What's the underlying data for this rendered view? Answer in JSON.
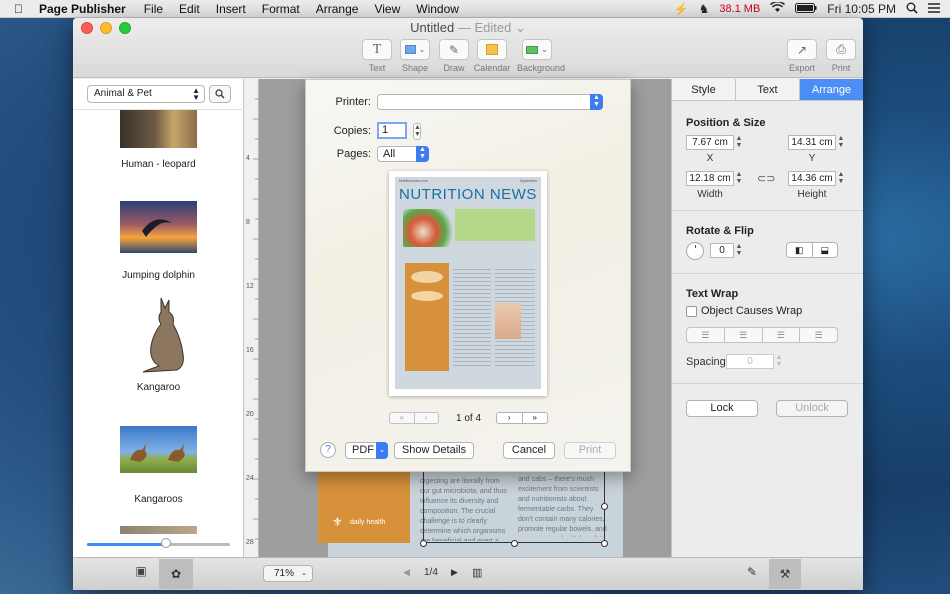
{
  "menubar": {
    "app": "Page Publisher",
    "items": [
      "File",
      "Edit",
      "Insert",
      "Format",
      "Arrange",
      "View",
      "Window"
    ],
    "memory": "38.1 MB",
    "clock": "Fri 10:05 PM"
  },
  "window": {
    "title": "Untitled",
    "edited": "— Edited",
    "toolbar": [
      "Text",
      "Shape",
      "Draw",
      "Calendar",
      "Background"
    ],
    "toolbar_right": [
      "Export",
      "Print"
    ]
  },
  "library": {
    "category": "Animal & Pet",
    "items": [
      "Human - leopard",
      "Jumping dolphin",
      "Kangaroo",
      "Kangaroos"
    ],
    "zoom_slider": 0.55
  },
  "print_dialog": {
    "printer_label": "Printer:",
    "printer_value": "",
    "copies_label": "Copies:",
    "copies_value": "1",
    "pages_label": "Pages:",
    "pages_value": "All",
    "page_indicator": "1 of 4",
    "help": "?",
    "pdf": "PDF",
    "show_details": "Show Details",
    "cancel": "Cancel",
    "print": "Print",
    "preview_title": "NUTRITION NEWS",
    "preview_left_meta": "Nutritionnews.com",
    "preview_right_meta": "September"
  },
  "canvas": {
    "ruler_marks": [
      "4",
      "8",
      "12",
      "16",
      "20",
      "24",
      "28"
    ],
    "footer_brand": "daily health",
    "body_text": "digesting are literally from our gut microbiota, and thus influence its diversity and composition. The crucial challenge is to clearly determine which organisms are beneficial and exert a preventive or",
    "body_text_2": "and cabs – there's much excitement from scientists and nutritionists about fermentable carbs. They don't contain many calories, promote regular bowels, and are associated with less fat storage after a meal."
  },
  "inspector": {
    "tabs": [
      "Style",
      "Text",
      "Arrange"
    ],
    "active_tab": "Arrange",
    "position_size": "Position & Size",
    "x": "7.67 cm",
    "y": "14.31 cm",
    "x_label": "X",
    "y_label": "Y",
    "width": "12.18 cm",
    "height": "14.36 cm",
    "width_label": "Width",
    "height_label": "Height",
    "rotate_flip": "Rotate & Flip",
    "rotation": "0",
    "text_wrap": "Text Wrap",
    "object_causes_wrap": "Object Causes Wrap",
    "spacing_label": "Spacing",
    "spacing_value": "0",
    "lock": "Lock",
    "unlock": "Unlock"
  },
  "bottom_bar": {
    "zoom": "71%",
    "page": "1/4"
  },
  "colors": {
    "accent": "#4c8ef4",
    "memory_red": "#d0021b",
    "preview_orange": "#d7913a",
    "preview_title_blue": "#1a6ea8"
  }
}
